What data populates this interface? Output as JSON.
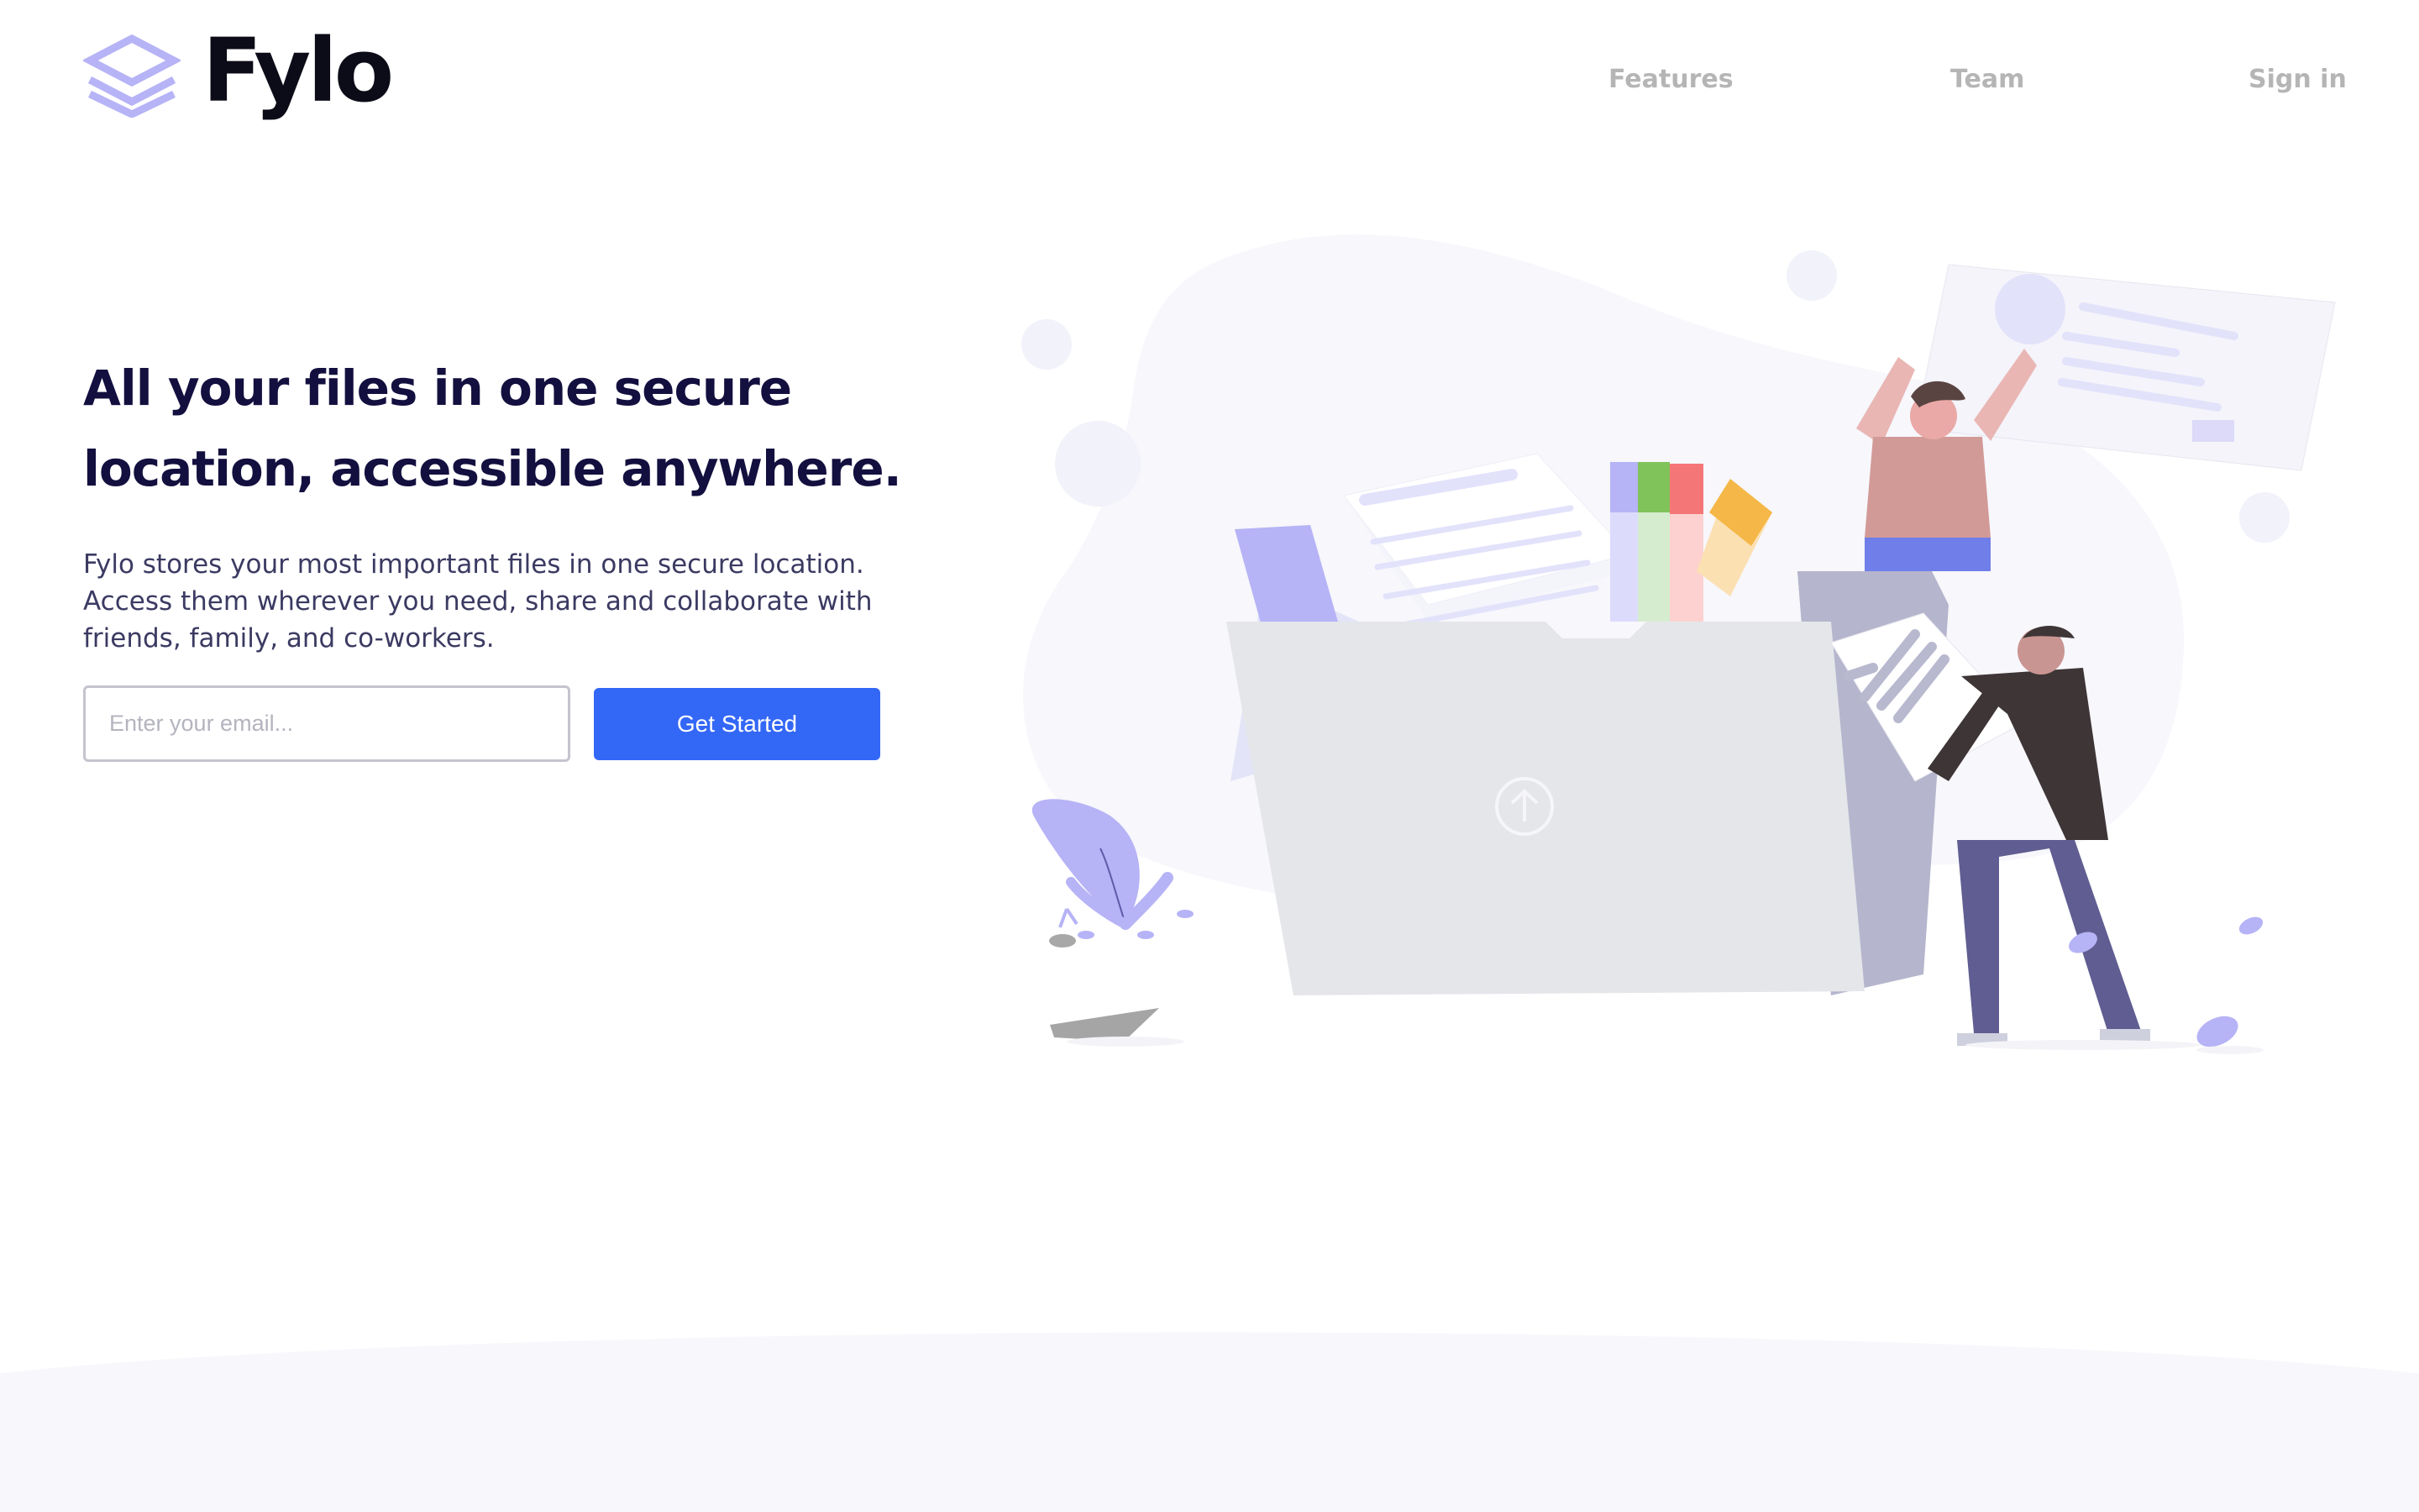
{
  "brand": {
    "name": "Fylo",
    "logo_icon": "stacked-layers-icon",
    "accent": "#3367f6",
    "logo_color": "#b6b3f6"
  },
  "nav": {
    "items": [
      "Features",
      "Team",
      "Sign in"
    ]
  },
  "hero": {
    "headline_lines": [
      "All your files in one secure",
      "location, accessible anywhere."
    ],
    "description_lines": [
      "Fylo stores your most important files in one secure location.",
      "Access them wherever you need, share and collaborate with",
      "friends, family, and co-workers."
    ]
  },
  "signup": {
    "email_placeholder": "Enter your email...",
    "email_value": "",
    "button_label": "Get Started"
  },
  "illustration": {
    "name": "people-organizing-files-illustration",
    "folder_icon": "upload-arrow-icon"
  },
  "colors": {
    "headline": "#130f3f",
    "body_text": "#3b3a62",
    "nav": "#b5b5b5",
    "background_tint": "#f7f7fc"
  }
}
